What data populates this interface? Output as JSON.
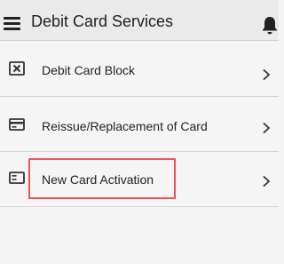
{
  "header": {
    "title": "Debit Card Services",
    "menu_icon": "hamburger-menu-icon",
    "notification_icon": "bell-icon"
  },
  "menu": {
    "items": [
      {
        "label": "Debit Card Block",
        "icon": "card-block-icon"
      },
      {
        "label": "Reissue/Replacement of Card",
        "icon": "credit-card-icon"
      },
      {
        "label": "New Card Activation",
        "icon": "card-activation-icon",
        "highlighted": true
      }
    ]
  },
  "colors": {
    "header_bg": "#eaeaea",
    "page_bg": "#f5f5f5",
    "text": "#222222",
    "highlight_border": "#e8545a"
  }
}
